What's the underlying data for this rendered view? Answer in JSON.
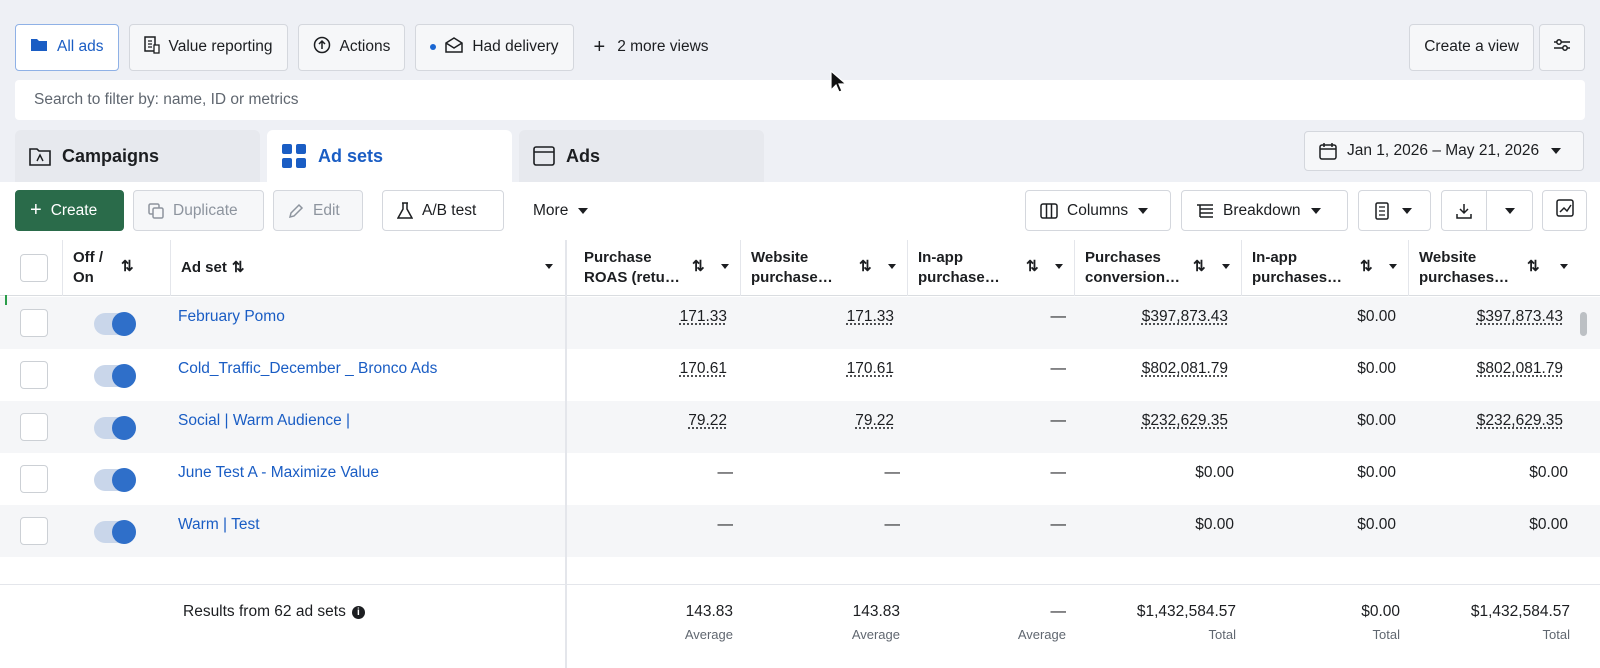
{
  "views": {
    "all_ads": "All ads",
    "value_reporting": "Value reporting",
    "actions": "Actions",
    "had_delivery": "Had delivery",
    "more_views": "2 more views",
    "create_view": "Create a view"
  },
  "search": {
    "placeholder": "Search to filter by: name, ID or metrics"
  },
  "tabs": {
    "campaigns": "Campaigns",
    "ad_sets": "Ad sets",
    "ads": "Ads"
  },
  "date_range": "Jan 1, 2026 – May 21, 2026",
  "toolbar": {
    "create": "Create",
    "duplicate": "Duplicate",
    "edit": "Edit",
    "ab_test": "A/B test",
    "more": "More",
    "columns": "Columns",
    "breakdown": "Breakdown"
  },
  "columns": {
    "off_on": [
      "Off /",
      "On"
    ],
    "ad_set": "Ad set",
    "purchase_roas": [
      "Purchase",
      "ROAS (retu…"
    ],
    "website_purchase": [
      "Website",
      "purchase…"
    ],
    "inapp_purchase": [
      "In-app",
      "purchase…"
    ],
    "purchases_conversion": [
      "Purchases",
      "conversion…"
    ],
    "inapp_purchases": [
      "In-app",
      "purchases…"
    ],
    "website_purchases": [
      "Website",
      "purchases…"
    ]
  },
  "rows": [
    {
      "name": "February Pomo",
      "roas": "171.33",
      "web_roas": "171.33",
      "inapp_roas": "—",
      "conv_value": "$397,873.43",
      "inapp_value": "$0.00",
      "web_value": "$397,873.43"
    },
    {
      "name": "Cold_Traffic_December _ Bronco Ads",
      "roas": "170.61",
      "web_roas": "170.61",
      "inapp_roas": "—",
      "conv_value": "$802,081.79",
      "inapp_value": "$0.00",
      "web_value": "$802,081.79"
    },
    {
      "name": "Social | Warm Audience |",
      "roas": "79.22",
      "web_roas": "79.22",
      "inapp_roas": "—",
      "conv_value": "$232,629.35",
      "inapp_value": "$0.00",
      "web_value": "$232,629.35"
    },
    {
      "name": "June Test A - Maximize Value",
      "roas": "—",
      "web_roas": "—",
      "inapp_roas": "—",
      "conv_value": "$0.00",
      "inapp_value": "$0.00",
      "web_value": "$0.00"
    },
    {
      "name": "Warm | Test",
      "roas": "—",
      "web_roas": "—",
      "inapp_roas": "—",
      "conv_value": "$0.00",
      "inapp_value": "$0.00",
      "web_value": "$0.00"
    }
  ],
  "footer": {
    "results": "Results from 62 ad sets",
    "roas": "143.83",
    "roas_label": "Average",
    "web_roas": "143.83",
    "web_roas_label": "Average",
    "inapp_roas": "—",
    "inapp_roas_label": "Average",
    "conv_value": "$1,432,584.57",
    "conv_value_label": "Total",
    "inapp_value": "$0.00",
    "inapp_value_label": "Total",
    "web_value": "$1,432,584.57",
    "web_value_label": "Total"
  }
}
